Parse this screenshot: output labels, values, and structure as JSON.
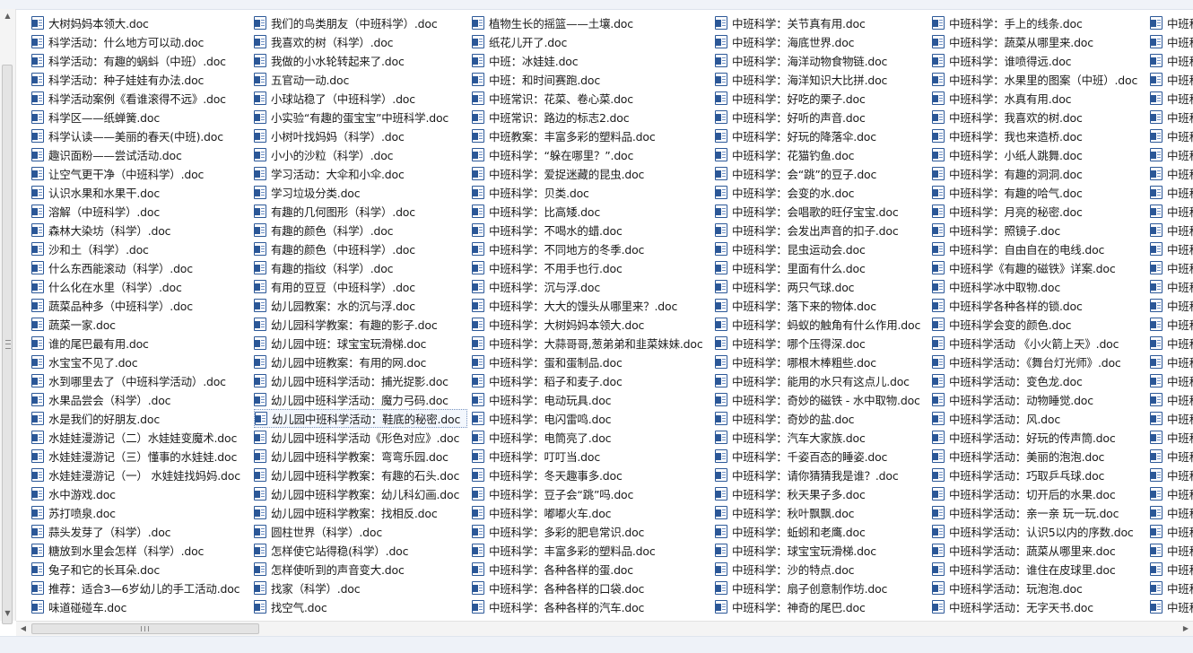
{
  "icons": {
    "file": "word-document-icon",
    "scroll_up": "scroll-up-arrow-icon",
    "scroll_down": "scroll-down-arrow-icon",
    "scroll_left": "scroll-left-arrow-icon",
    "scroll_right": "scroll-right-arrow-icon"
  },
  "colors": {
    "icon_blue": "#2b5797",
    "text": "#1b1b1b",
    "selection_border": "#7a95c0"
  },
  "selected": {
    "column": 1,
    "row": 21
  },
  "columns": [
    [
      "大树妈妈本领大.doc",
      "科学活动：什么地方可以动.doc",
      "科学活动：有趣的蜗蚪（中班）.doc",
      "科学活动：种子娃娃有办法.doc",
      "科学活动案例《看谁滚得不远》.doc",
      "科学区——纸蝉簧.doc",
      "科学认读——美丽的春天(中班).doc",
      "趣识面粉——尝试活动.doc",
      "让空气更干净（中班科学）.doc",
      "认识水果和水果干.doc",
      "溶解（中班科学）.doc",
      "森林大染坊（科学）.doc",
      "沙和土（科学）.doc",
      "什么东西能滚动（科学）.doc",
      "什么化在水里（科学）.doc",
      "蔬菜品种多（中班科学）.doc",
      "蔬菜一家.doc",
      "谁的尾巴最有用.doc",
      "水宝宝不见了.doc",
      "水到哪里去了（中班科学活动）.doc",
      "水果品尝会（科学）.doc",
      "水是我们的好朋友.doc",
      "水娃娃漫游记（二）水娃娃变魔术.doc",
      "水娃娃漫游记（三）懂事的水娃娃.doc",
      "水娃娃漫游记（一） 水娃娃找妈妈.doc",
      "水中游戏.doc",
      "苏打喷泉.doc",
      "蒜头发芽了（科学）.doc",
      "糖放到水里会怎样（科学）.doc",
      "兔子和它的长耳朵.doc",
      "推荐：适合3—6岁幼儿的手工活动.doc",
      "味道碰碰车.doc"
    ],
    [
      "我们的鸟类朋友（中班科学）.doc",
      "我喜欢的树（科学）.doc",
      "我做的小水轮转起来了.doc",
      "五官动一动.doc",
      "小球站稳了（中班科学）.doc",
      "小实验“有趣的蛋宝宝”中班科学.doc",
      "小树叶找妈妈（科学）.doc",
      "小小的沙粒（科学）.doc",
      "学习活动：大伞和小伞.doc",
      "学习垃圾分类.doc",
      "有趣的几何图形（科学）.doc",
      "有趣的颜色（科学）.doc",
      "有趣的颜色（中班科学）.doc",
      "有趣的指纹（科学）.doc",
      "有用的豆豆（中班科学）.doc",
      "幼儿园教案：水的沉与浮.doc",
      "幼儿园科学教案：有趣的影子.doc",
      "幼儿园中班：球宝宝玩滑梯.doc",
      "幼儿园中班教案：有用的网.doc",
      "幼儿园中班科学活动：捕光捉影.doc",
      "幼儿园中班科学活动：魔力弓码.doc",
      "幼儿园中班科学活动：鞋底的秘密.doc",
      "幼儿园中班科学活动《形色对应》.doc",
      "幼儿园中班科学教案：弯弯乐园.doc",
      "幼儿园中班科学教案：有趣的石头.doc",
      "幼儿园中班科学教案：幼儿科幻画.doc",
      "幼儿园中班科学教案：找相反.doc",
      "圆柱世界（科学）.doc",
      "怎样使它站得稳(科学）.doc",
      "怎样使听到的声音变大.doc",
      "找家（科学）.doc",
      "找空气.doc"
    ],
    [
      "植物生长的摇篮——土壤.doc",
      "纸花儿开了.doc",
      "中班：冰娃娃.doc",
      "中班：和时间赛跑.doc",
      "中班常识：花菜、卷心菜.doc",
      "中班常识：路边的标志2.doc",
      "中班教案：丰富多彩的塑料品.doc",
      "中班科学：“躲在哪里？”.doc",
      "中班科学：爱捉迷藏的昆虫.doc",
      "中班科学：贝类.doc",
      "中班科学：比高矮.doc",
      "中班科学：不喝水的蜡.doc",
      "中班科学：不同地方的冬季.doc",
      "中班科学：不用手也行.doc",
      "中班科学：沉与浮.doc",
      "中班科学：大大的馒头从哪里来？.doc",
      "中班科学：大树妈妈本领大.doc",
      "中班科学：大蒜哥哥,葱弟弟和韭菜妹妹.doc",
      "中班科学：蛋和蛋制品.doc",
      "中班科学：稻子和麦子.doc",
      "中班科学：电动玩具.doc",
      "中班科学：电闪雷鸣.doc",
      "中班科学：电筒亮了.doc",
      "中班科学：叮叮当.doc",
      "中班科学：冬天趣事多.doc",
      "中班科学：豆子会“跳”吗.doc",
      "中班科学：嘟嘟火车.doc",
      "中班科学：多彩的肥皂常识.doc",
      "中班科学：丰富多彩的塑料品.doc",
      "中班科学：各种各样的蛋.doc",
      "中班科学：各种各样的口袋.doc",
      "中班科学：各种各样的汽车.doc"
    ],
    [
      "中班科学：关节真有用.doc",
      "中班科学：海底世界.doc",
      "中班科学：海洋动物食物链.doc",
      "中班科学：海洋知识大比拼.doc",
      "中班科学：好吃的栗子.doc",
      "中班科学：好听的声音.doc",
      "中班科学：好玩的降落伞.doc",
      "中班科学：花猫钓鱼.doc",
      "中班科学：会“跳”的豆子.doc",
      "中班科学：会变的水.doc",
      "中班科学：会唱歌的旺仔宝宝.doc",
      "中班科学：会发出声音的扣子.doc",
      "中班科学：昆虫运动会.doc",
      "中班科学：里面有什么.doc",
      "中班科学：两只气球.doc",
      "中班科学：落下来的物体.doc",
      "中班科学：蚂蚁的触角有什么作用.doc",
      "中班科学：哪个压得深.doc",
      "中班科学：哪根木棒粗些.doc",
      "中班科学：能用的水只有这点儿.doc",
      "中班科学：奇妙的磁铁 - 水中取物.doc",
      "中班科学：奇妙的盐.doc",
      "中班科学：汽车大家族.doc",
      "中班科学：千姿百态的睡姿.doc",
      "中班科学：请你猜猜我是谁？.doc",
      "中班科学：秋天果子多.doc",
      "中班科学：秋叶飘飘.doc",
      "中班科学：蚯蚓和老鹰.doc",
      "中班科学：球宝宝玩滑梯.doc",
      "中班科学：沙的特点.doc",
      "中班科学：扇子创意制作坊.doc",
      "中班科学：神奇的尾巴.doc"
    ],
    [
      "中班科学：手上的线条.doc",
      "中班科学：蔬菜从哪里来.doc",
      "中班科学：谁喷得远.doc",
      "中班科学：水果里的图案（中班）.doc",
      "中班科学：水真有用.doc",
      "中班科学：我喜欢的树.doc",
      "中班科学：我也来造桥.doc",
      "中班科学：小纸人跳舞.doc",
      "中班科学：有趣的洞洞.doc",
      "中班科学：有趣的哈气.doc",
      "中班科学：月亮的秘密.doc",
      "中班科学：照镜子.doc",
      "中班科学：自由自在的电线.doc",
      "中班科学《有趣的磁铁》详案.doc",
      "中班科学冰中取物.doc",
      "中班科学各种各样的锁.doc",
      "中班科学会变的颜色.doc",
      "中班科学活动 《小火箭上天》.doc",
      "中班科学活动：《舞台灯光师》.doc",
      "中班科学活动：变色龙.doc",
      "中班科学活动：动物睡觉.doc",
      "中班科学活动：风.doc",
      "中班科学活动：好玩的传声筒.doc",
      "中班科学活动：美丽的泡泡.doc",
      "中班科学活动：巧取乒乓球.doc",
      "中班科学活动：切开后的水果.doc",
      "中班科学活动：亲一亲 玩一玩.doc",
      "中班科学活动：认识5以内的序数.doc",
      "中班科学活动：蔬菜从哪里来.doc",
      "中班科学活动：谁住在皮球里.doc",
      "中班科学活动：玩泡泡.doc",
      "中班科学活动：无字天书.doc"
    ],
    [
      "中班科学",
      "中班科学",
      "中班科学",
      "中班科学",
      "中班科学",
      "中班科学",
      "中班科学",
      "中班科学",
      "中班科学",
      "中班科学",
      "中班科学",
      "中班科学",
      "中班科学",
      "中班科学",
      "中班科学",
      "中班科学",
      "中班科学",
      "中班科学",
      "中班科学",
      "中班科学",
      "中班科学",
      "中班科学",
      "中班科学",
      "中班科学",
      "中班科学",
      "中班科学",
      "中班科学",
      "中班科学",
      "中班科学",
      "中班科学",
      "中班科学",
      "中班科学"
    ]
  ]
}
